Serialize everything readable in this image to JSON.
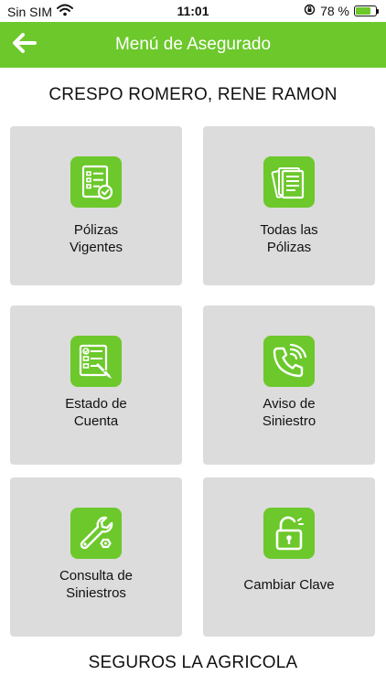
{
  "status_bar": {
    "carrier": "Sin SIM",
    "time": "11:01",
    "battery_percent": "78 %",
    "battery_level": 0.78
  },
  "header": {
    "title": "Menú de Asegurado",
    "back_icon": "arrow-left-icon"
  },
  "user": {
    "name": "CRESPO ROMERO, RENE RAMON"
  },
  "menu": {
    "items": [
      {
        "label": "Pólizas\nVigentes",
        "icon": "document-check-icon"
      },
      {
        "label": "Todas las\nPólizas",
        "icon": "documents-stack-icon"
      },
      {
        "label": "Estado de\nCuenta",
        "icon": "checklist-pen-icon"
      },
      {
        "label": "Aviso de\nSiniestro",
        "icon": "phone-call-icon"
      },
      {
        "label": "Consulta de\nSiniestros",
        "icon": "wrench-icon"
      },
      {
        "label": "Cambiar Clave",
        "icon": "unlock-icon"
      }
    ]
  },
  "footer": {
    "text": "SEGUROS LA AGRICOLA"
  },
  "colors": {
    "accent": "#6cc82b",
    "tile_background": "#dcdcdc",
    "header_text": "#ffffff"
  }
}
